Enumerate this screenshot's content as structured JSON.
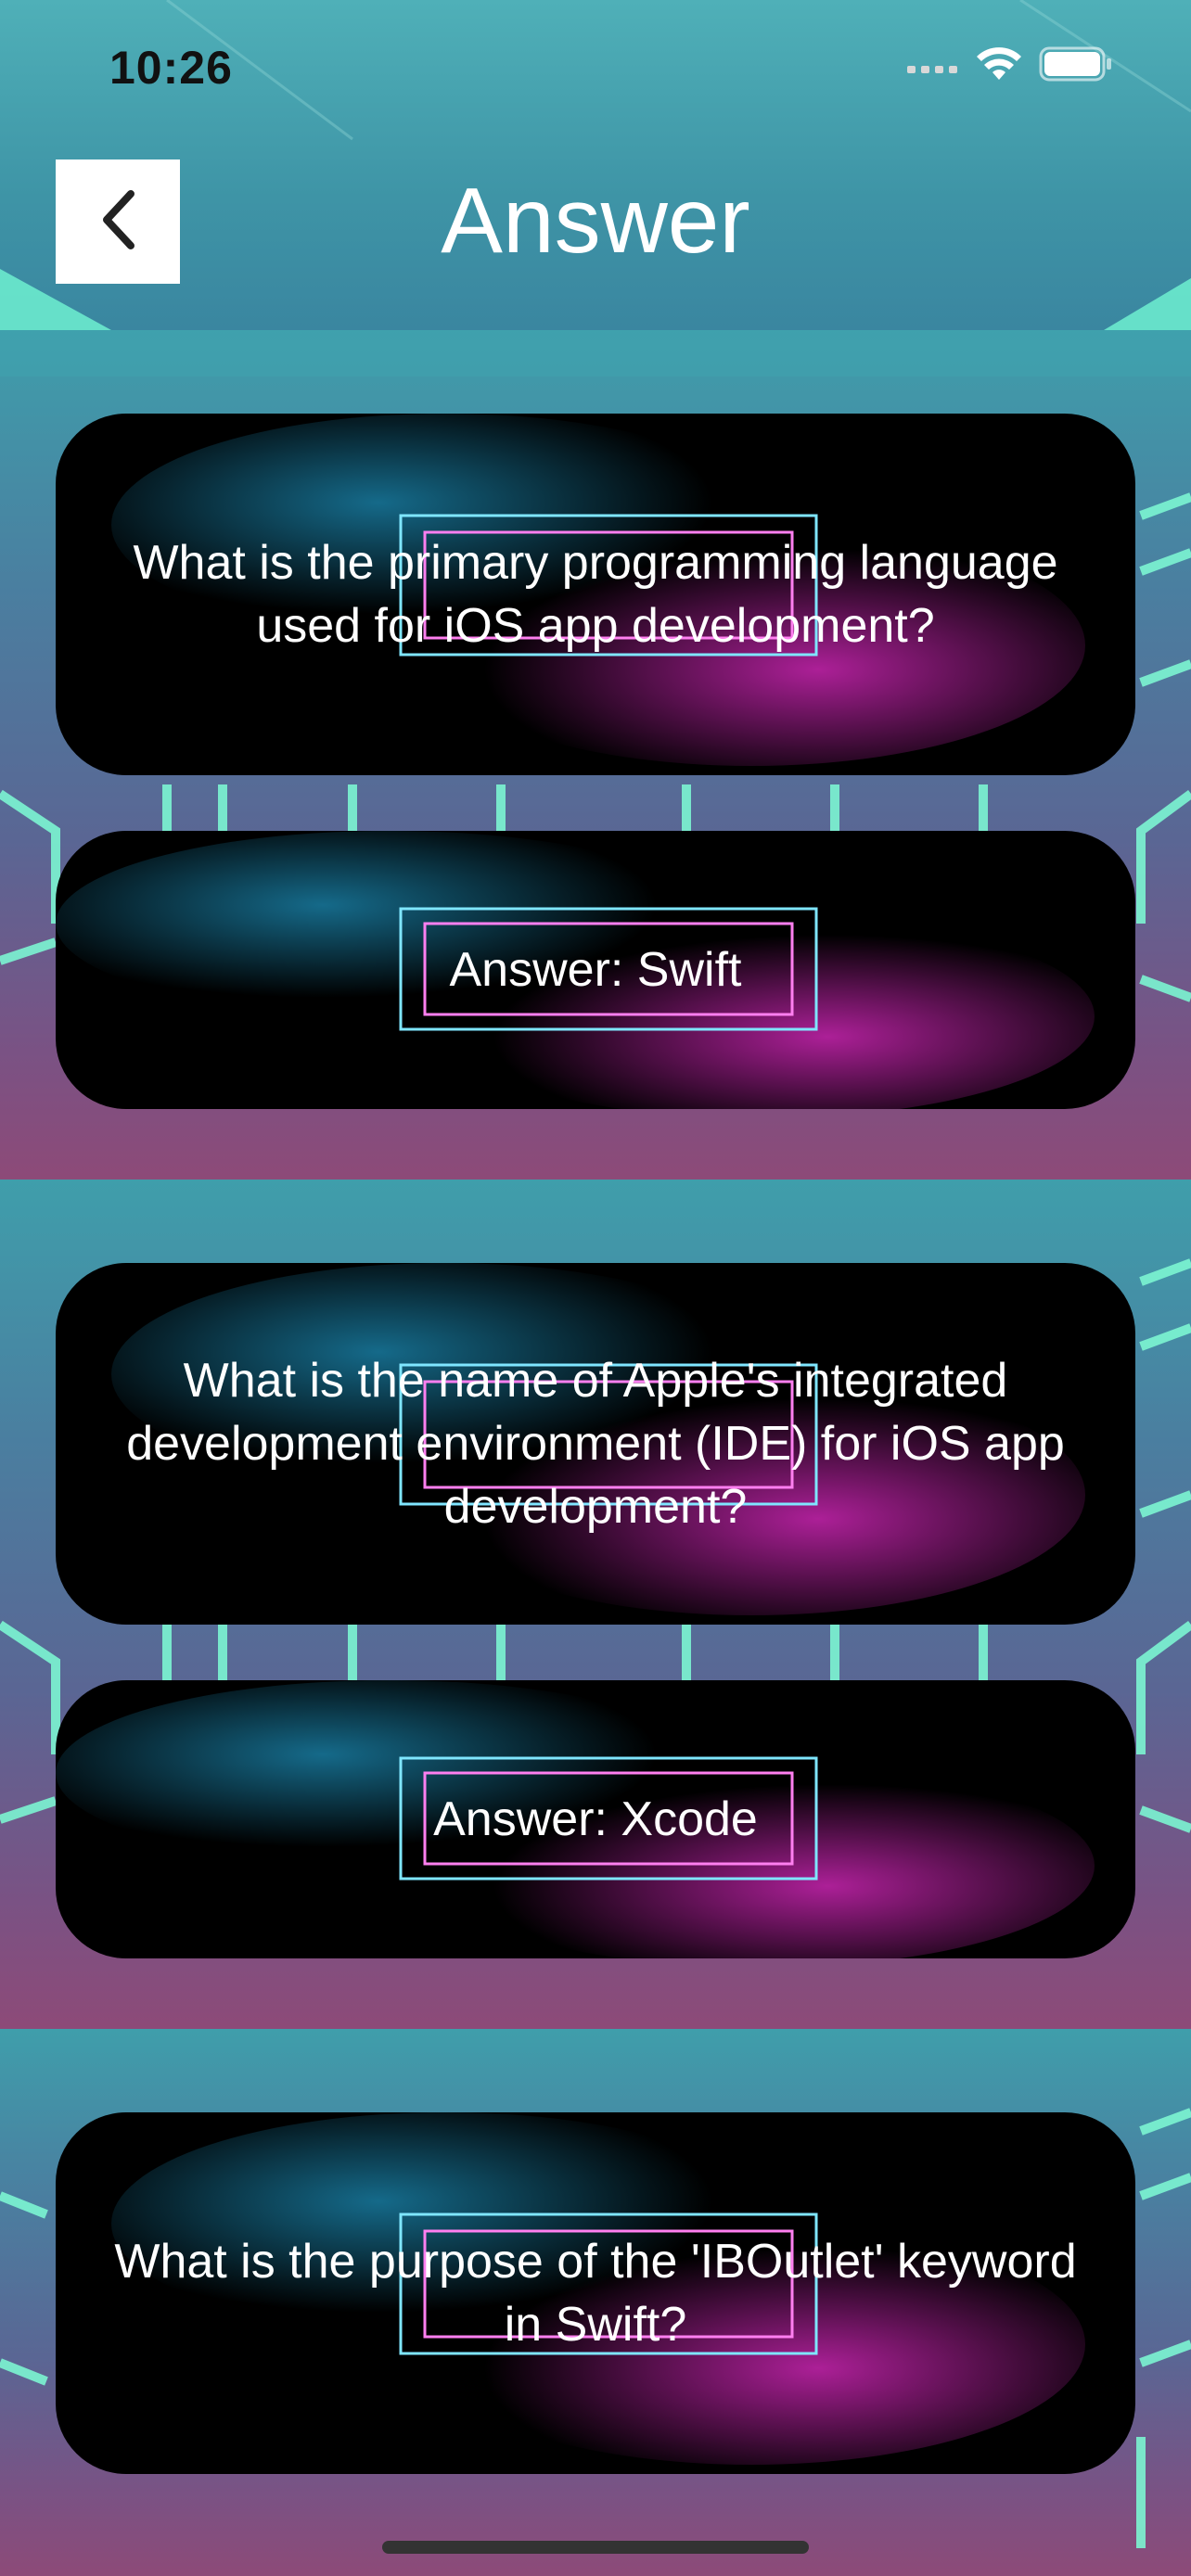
{
  "status_bar": {
    "time": "10:26"
  },
  "nav": {
    "title": "Answer",
    "back_icon": "chevron-left-icon"
  },
  "qa_items": [
    {
      "question": "What is the primary programming language used for iOS app development?",
      "answer": "Answer: Swift"
    },
    {
      "question": "What is the name of Apple's integrated development environment (IDE) for iOS app development?",
      "answer": "Answer: Xcode"
    },
    {
      "question": "What is the purpose of the 'IBOutlet' keyword in Swift?"
    }
  ],
  "colors": {
    "neon_cyan": "#27c4ff",
    "neon_magenta": "#ff2fe0",
    "card_background": "#000000",
    "accent_green": "#7cf5d2"
  }
}
